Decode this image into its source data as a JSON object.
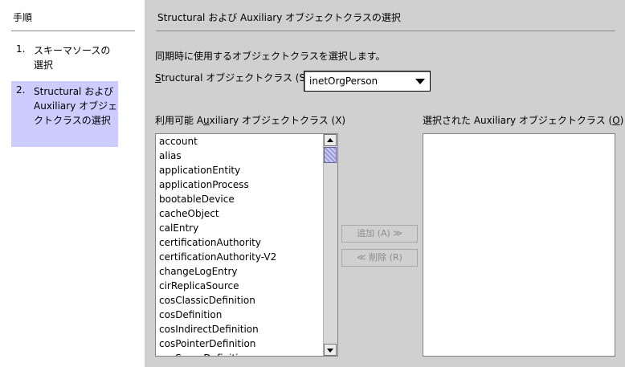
{
  "steps": {
    "title": "手順",
    "items": [
      {
        "num": "1.",
        "label": "スキーマソースの選択"
      },
      {
        "num": "2.",
        "label": "Structural および Auxiliary オブジェクトクラスの選択"
      }
    ]
  },
  "main": {
    "title": "Structural および Auxiliary オブジェクトクラスの選択",
    "description": "同期時に使用するオブジェクトクラスを選択します。",
    "structural": {
      "label_prefix": "S",
      "label_rest": "tructural オブジェクトクラス (S):",
      "selected_value": "inetOrgPerson"
    },
    "available": {
      "label_before": "利用可能 A",
      "label_u": "u",
      "label_after": "xiliary オブジェクトクラス (X)",
      "items": [
        "account",
        "alias",
        "applicationEntity",
        "applicationProcess",
        "bootableDevice",
        "cacheObject",
        "calEntry",
        "certificationAuthority",
        "certificationAuthority-V2",
        "changeLogEntry",
        "cirReplicaSource",
        "cosClassicDefinition",
        "cosDefinition",
        "cosIndirectDefinition",
        "cosPointerDefinition",
        "cosSuperDefinition"
      ]
    },
    "selected": {
      "label_before": "選択された Auxiliary オブジェクトクラス (",
      "label_u": "O",
      "label_after": ")"
    },
    "buttons": {
      "add": "追加 (A) ≫",
      "remove": "≪ 削除 (R)"
    }
  }
}
